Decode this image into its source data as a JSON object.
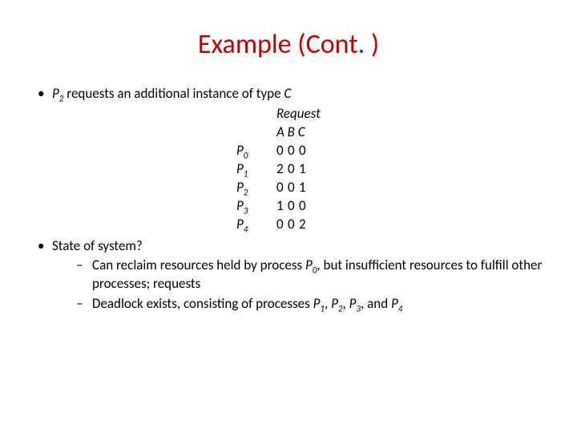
{
  "title": "Example (Cont. )",
  "bullet1_pre": "P",
  "bullet1_sub": "2",
  "bullet1_post": " requests an additional instance of type ",
  "bullet1_c": "C",
  "table": {
    "header": "Request",
    "colhdr": "A B C",
    "rows": [
      {
        "label": "P",
        "sub": "0",
        "a": "0",
        "b": "0",
        "c": "0"
      },
      {
        "label": "P",
        "sub": "1",
        "a": "2",
        "b": "0",
        "c": "1"
      },
      {
        "label": "P",
        "sub": "2",
        "a": "0",
        "b": "0",
        "c": "1"
      },
      {
        "label": "P",
        "sub": "3",
        "a": "1",
        "b": "0",
        "c": "0"
      },
      {
        "label": "P",
        "sub": "4",
        "a": "0",
        "b": "0",
        "c": "2"
      }
    ]
  },
  "bullet2": "State of system?",
  "sub1_a": "Can reclaim resources held by process ",
  "sub1_p": "P",
  "sub1_psub": "0",
  "sub1_b": ", but insufficient resources to fulfill other processes; requests",
  "sub2_a": "Deadlock exists, consisting of processes ",
  "sub2_p1": "P",
  "sub2_p1s": "1",
  "sub2_sep1": ", ",
  "sub2_p2": "P",
  "sub2_p2s": "2",
  "sub2_sep2": ", ",
  "sub2_p3": "P",
  "sub2_p3s": "3",
  "sub2_sep3": ", and ",
  "sub2_p4": "P",
  "sub2_p4s": "4"
}
